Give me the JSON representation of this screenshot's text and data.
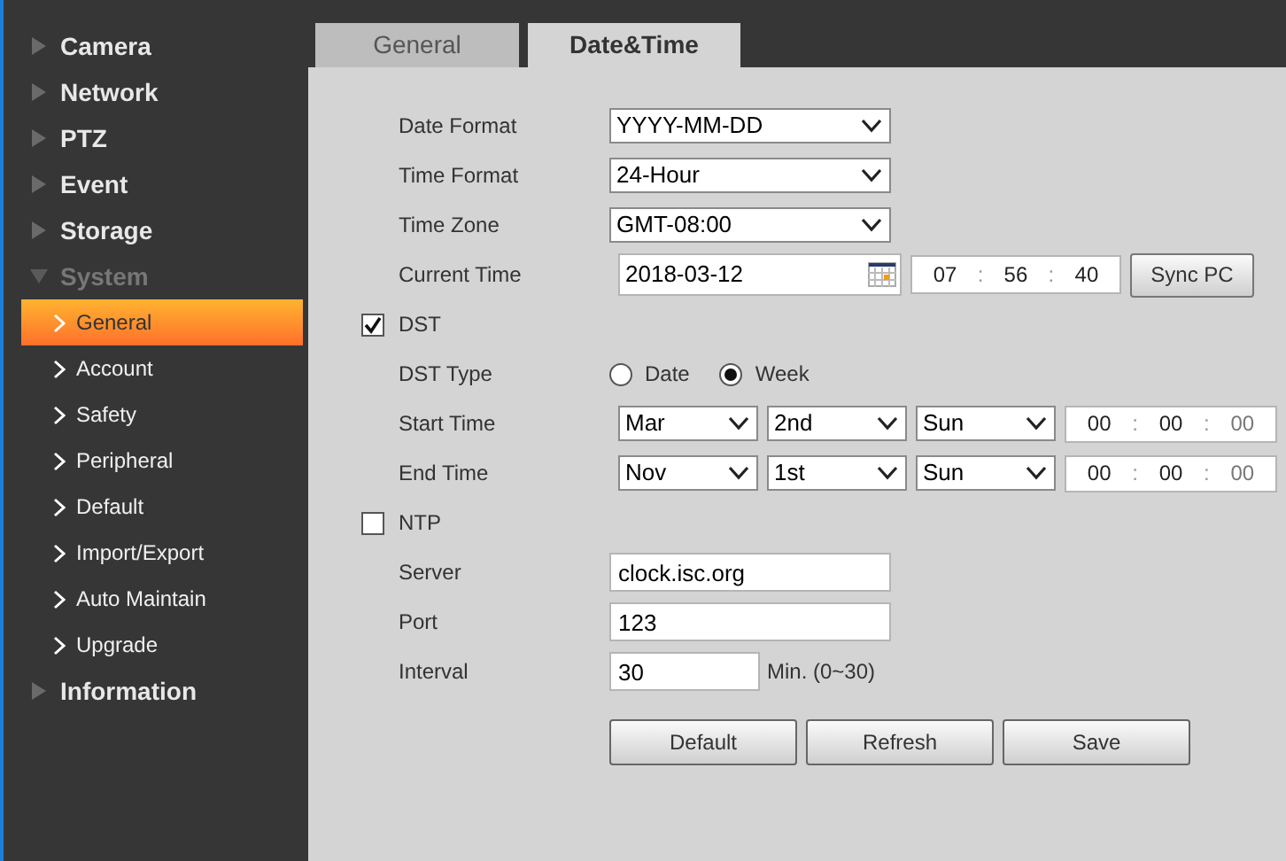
{
  "sidebar": {
    "items": [
      {
        "label": "Camera",
        "expanded": false
      },
      {
        "label": "Network",
        "expanded": false
      },
      {
        "label": "PTZ",
        "expanded": false
      },
      {
        "label": "Event",
        "expanded": false
      },
      {
        "label": "Storage",
        "expanded": false
      },
      {
        "label": "System",
        "expanded": true,
        "children": [
          {
            "label": "General",
            "selected": true
          },
          {
            "label": "Account",
            "selected": false
          },
          {
            "label": "Safety",
            "selected": false
          },
          {
            "label": "Peripheral",
            "selected": false
          },
          {
            "label": "Default",
            "selected": false
          },
          {
            "label": "Import/Export",
            "selected": false
          },
          {
            "label": "Auto Maintain",
            "selected": false
          },
          {
            "label": "Upgrade",
            "selected": false
          }
        ]
      },
      {
        "label": "Information",
        "expanded": false
      }
    ]
  },
  "tabs": [
    {
      "label": "General",
      "selected": false
    },
    {
      "label": "Date&Time",
      "selected": true
    }
  ],
  "form": {
    "date_format": {
      "label": "Date Format",
      "value": "YYYY-MM-DD"
    },
    "time_format": {
      "label": "Time Format",
      "value": "24-Hour"
    },
    "time_zone": {
      "label": "Time Zone",
      "value": "GMT-08:00"
    },
    "current_time": {
      "label": "Current Time",
      "date": "2018-03-12",
      "time": [
        "07",
        "56",
        "40"
      ],
      "separators": [
        ":",
        ":"
      ],
      "button": "Sync PC"
    },
    "dst": {
      "label": "DST",
      "checked": true
    },
    "dst_type": {
      "label": "DST Type",
      "options": [
        {
          "label": "Date",
          "selected": false
        },
        {
          "label": "Week",
          "selected": true
        }
      ]
    },
    "start_time": {
      "label": "Start Time",
      "month": "Mar",
      "week": "2nd",
      "day": "Sun",
      "time": [
        "00",
        "00",
        "00"
      ],
      "separators": [
        ":",
        ":"
      ]
    },
    "end_time": {
      "label": "End Time",
      "month": "Nov",
      "week": "1st",
      "day": "Sun",
      "time": [
        "00",
        "00",
        "00"
      ],
      "separators": [
        ":",
        ":"
      ]
    },
    "ntp": {
      "label": "NTP",
      "checked": false
    },
    "server": {
      "label": "Server",
      "value": "clock.isc.org"
    },
    "port": {
      "label": "Port",
      "value": "123"
    },
    "interval": {
      "label": "Interval",
      "value": "30",
      "unit": "Min. (0~30)"
    }
  },
  "buttons": [
    "Default",
    "Refresh",
    "Save"
  ]
}
